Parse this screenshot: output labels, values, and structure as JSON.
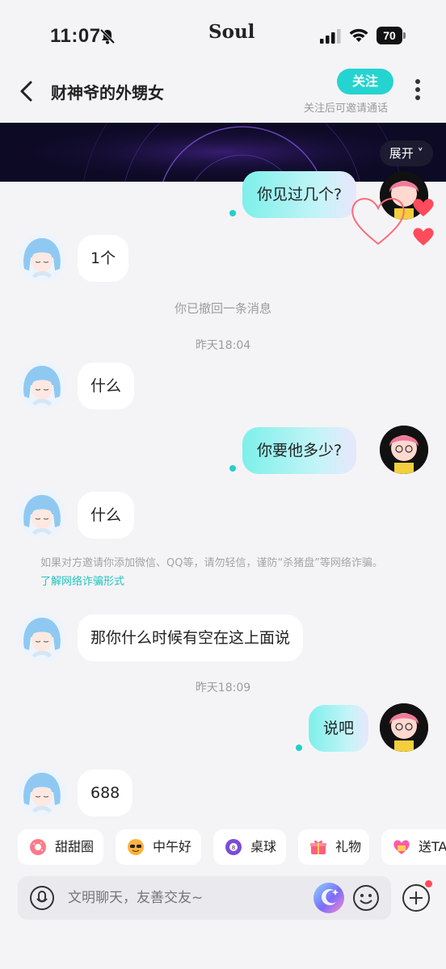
{
  "status_bar": {
    "time": "11:07",
    "carrier": "Soul",
    "battery": "70"
  },
  "header": {
    "title": "财神爷的外甥女",
    "follow": "关注",
    "follow_hint": "关注后可邀请通话"
  },
  "banner": {
    "expand": "展开 ˅"
  },
  "messages": [
    {
      "from": "me",
      "text": "你见过几个?"
    },
    {
      "from": "her",
      "text": "1个"
    },
    {
      "from": "system",
      "text": "你已撤回一条消息"
    },
    {
      "from": "time",
      "text": "昨天18:04"
    },
    {
      "from": "her",
      "text": "什么"
    },
    {
      "from": "me",
      "text": "你要他多少?"
    },
    {
      "from": "her",
      "text": "什么"
    },
    {
      "from": "her",
      "text": "那你什么时候有空在这上面说"
    },
    {
      "from": "time",
      "text": "昨天18:09"
    },
    {
      "from": "me",
      "text": "说吧"
    },
    {
      "from": "her",
      "text": "688"
    }
  ],
  "warning": {
    "text": "如果对方邀请你添加微信、QQ等，请勿轻信，谨防“杀猪盘”等网络诈骗。",
    "link": "了解网络诈骗形式"
  },
  "quick_chips": [
    {
      "label": "甜甜圈",
      "icon": "donut-icon"
    },
    {
      "label": "中午好",
      "icon": "sunglasses-sun-icon"
    },
    {
      "label": "桌球",
      "icon": "billiard-ball-icon"
    },
    {
      "label": "礼物",
      "icon": "gift-icon"
    },
    {
      "label": "送TA",
      "icon": "heart-gift-icon"
    }
  ],
  "input": {
    "placeholder": "文明聊天，友善交友~"
  },
  "colors": {
    "accent": "#25d4d0",
    "heart": "#ff4b5c",
    "banner_bg": "#0d0a25"
  }
}
